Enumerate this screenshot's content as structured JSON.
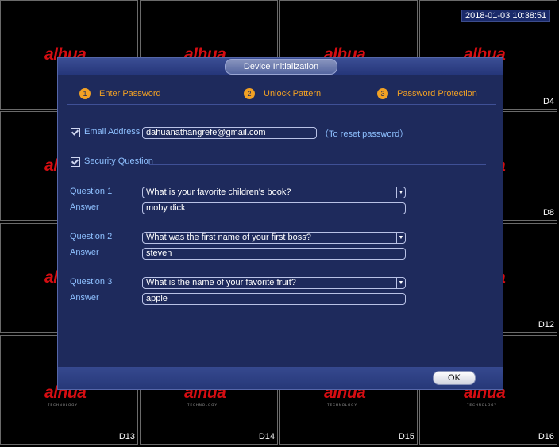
{
  "clock": "2018-01-03 10:38:51",
  "logo_text": "alhua",
  "logo_sub": "TECHNOLOGY",
  "channels": {
    "c4": "D4",
    "c8": "D8",
    "c12": "D12",
    "c13": "D13",
    "c14": "D14",
    "c15": "D15",
    "c16": "D16"
  },
  "dialog": {
    "title": "Device Initialization",
    "steps": [
      {
        "num": "1",
        "label": "Enter Password"
      },
      {
        "num": "2",
        "label": "Unlock Pattern"
      },
      {
        "num": "3",
        "label": "Password Protection"
      }
    ],
    "email": {
      "label": "Email Address",
      "value": "dahuanathangrefe@gmail.com",
      "hint": "（To reset password）"
    },
    "security_label": "Security Question",
    "questions": [
      {
        "label": "Question 1",
        "question": "What is your favorite children's book?",
        "answer_label": "Answer",
        "answer": "moby dick"
      },
      {
        "label": "Question 2",
        "question": "What was the first name of your first boss?",
        "answer_label": "Answer",
        "answer": "steven"
      },
      {
        "label": "Question 3",
        "question": "What is the name of your favorite fruit?",
        "answer_label": "Answer",
        "answer": "apple"
      }
    ],
    "ok_label": "OK"
  },
  "colors": {
    "accent": "#f2a124",
    "dialog_bg": "#1e2a5c",
    "label": "#8ec0ff",
    "logo": "#d50d12"
  }
}
